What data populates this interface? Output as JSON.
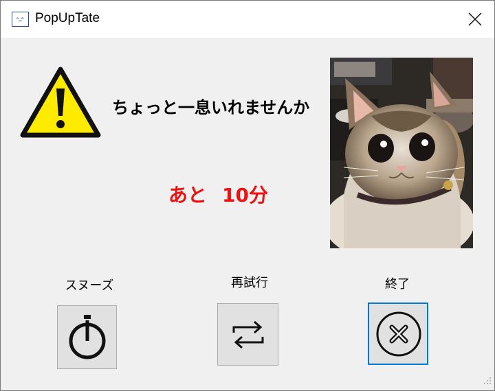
{
  "window": {
    "title": "PopUpTate",
    "icon": "app-face-icon"
  },
  "main": {
    "message": "ちょっと一息いれませんか",
    "remaining_prefix": "あと",
    "remaining_value": "10分",
    "warning_icon": "warning-icon",
    "photo": "cat-photo"
  },
  "buttons": {
    "snooze_label": "スヌーズ",
    "retry_label": "再試行",
    "exit_label": "終了"
  },
  "colors": {
    "remaining_text": "#ee1111",
    "warning_fill": "#ffeb00",
    "focus_border": "#0078d7"
  }
}
